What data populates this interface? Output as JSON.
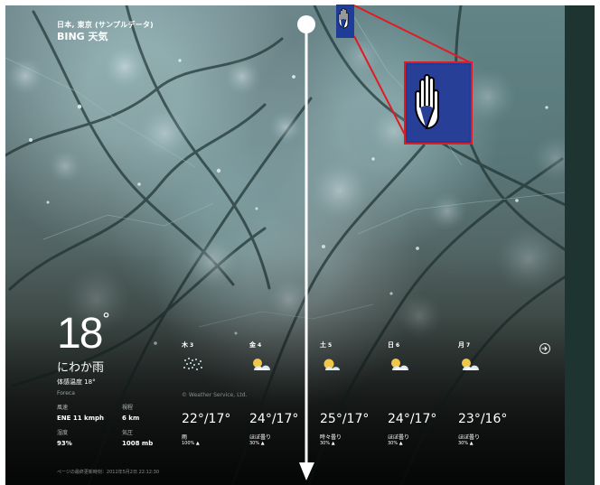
{
  "header": {
    "location": "日本, 東京 (サンプルデータ)",
    "app_title": "BING 天気"
  },
  "current": {
    "temperature": "18",
    "degree": "°",
    "condition": "にわか雨",
    "feels_like": "体感温度 18°",
    "provider": "Foreca"
  },
  "details": [
    {
      "label": "風速",
      "value": "ENE 11 kmph"
    },
    {
      "label": "視程",
      "value": "6 km"
    },
    {
      "label": "湿度",
      "value": "93%"
    },
    {
      "label": "気圧",
      "value": "1008 mb"
    }
  ],
  "forecast": [
    {
      "day": "木",
      "date": "3",
      "icon": "showers-icon",
      "temp": "22°/17°",
      "condition": "雨",
      "rain": "100% ▲"
    },
    {
      "day": "金",
      "date": "4",
      "icon": "partly-sunny-icon",
      "temp": "24°/17°",
      "condition": "ほぼ曇り",
      "rain": "30% ▲"
    },
    {
      "day": "土",
      "date": "5",
      "icon": "partly-cloudy-icon",
      "temp": "25°/17°",
      "condition": "時々曇り",
      "rain": "30% ▲"
    },
    {
      "day": "日",
      "date": "6",
      "icon": "partly-sunny-icon",
      "temp": "24°/17°",
      "condition": "ほぼ曇り",
      "rain": "30% ▲"
    },
    {
      "day": "月",
      "date": "7",
      "icon": "partly-sunny-icon",
      "temp": "23°/16°",
      "condition": "ほぼ曇り",
      "rain": "30% ▲"
    }
  ],
  "service": "© Weather Service, Ltd.",
  "updated": "ページの最終更新時刻：2012年5月2日 22:12:30",
  "colors": {
    "text": "#ffffff",
    "sidebar": "#1d3431",
    "hand_blue": "#1f3d98",
    "hand_border": "#e01b24"
  },
  "icons": {
    "next": "arrow-right-circle-icon",
    "cursor": "hand-cursor-icon"
  }
}
